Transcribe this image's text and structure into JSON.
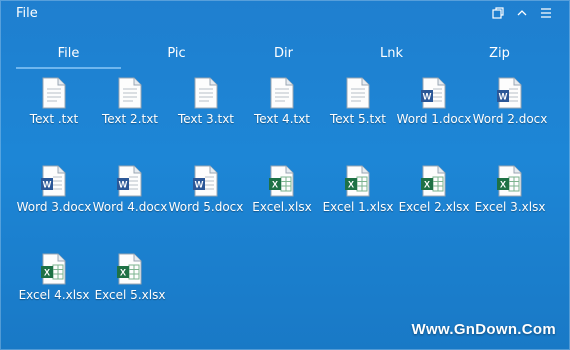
{
  "window": {
    "title": "File"
  },
  "titlebar_icons": [
    "restore-icon",
    "chevron-up-icon",
    "menu-icon"
  ],
  "tabs": [
    {
      "label": "File",
      "active": true
    },
    {
      "label": "Pic"
    },
    {
      "label": "Dir"
    },
    {
      "label": "Lnk"
    },
    {
      "label": "Zip"
    }
  ],
  "files": [
    {
      "name": "Text .txt",
      "type": "txt"
    },
    {
      "name": "Text 2.txt",
      "type": "txt"
    },
    {
      "name": "Text 3.txt",
      "type": "txt"
    },
    {
      "name": "Text 4.txt",
      "type": "txt"
    },
    {
      "name": "Text 5.txt",
      "type": "txt"
    },
    {
      "name": "Word 1.docx",
      "type": "docx"
    },
    {
      "name": "Word 2.docx",
      "type": "docx"
    },
    {
      "name": "Word 3.docx",
      "type": "docx"
    },
    {
      "name": "Word 4.docx",
      "type": "docx"
    },
    {
      "name": "Word 5.docx",
      "type": "docx"
    },
    {
      "name": "Excel.xlsx",
      "type": "xlsx"
    },
    {
      "name": "Excel 1.xlsx",
      "type": "xlsx"
    },
    {
      "name": "Excel 2.xlsx",
      "type": "xlsx"
    },
    {
      "name": "Excel 3.xlsx",
      "type": "xlsx"
    },
    {
      "name": "Excel 4.xlsx",
      "type": "xlsx"
    },
    {
      "name": "Excel 5.xlsx",
      "type": "xlsx"
    }
  ],
  "watermark": "Www.GnDown.Com",
  "colors": {
    "background": "#1d86d6",
    "word": "#2b5797",
    "excel": "#1e7145"
  }
}
